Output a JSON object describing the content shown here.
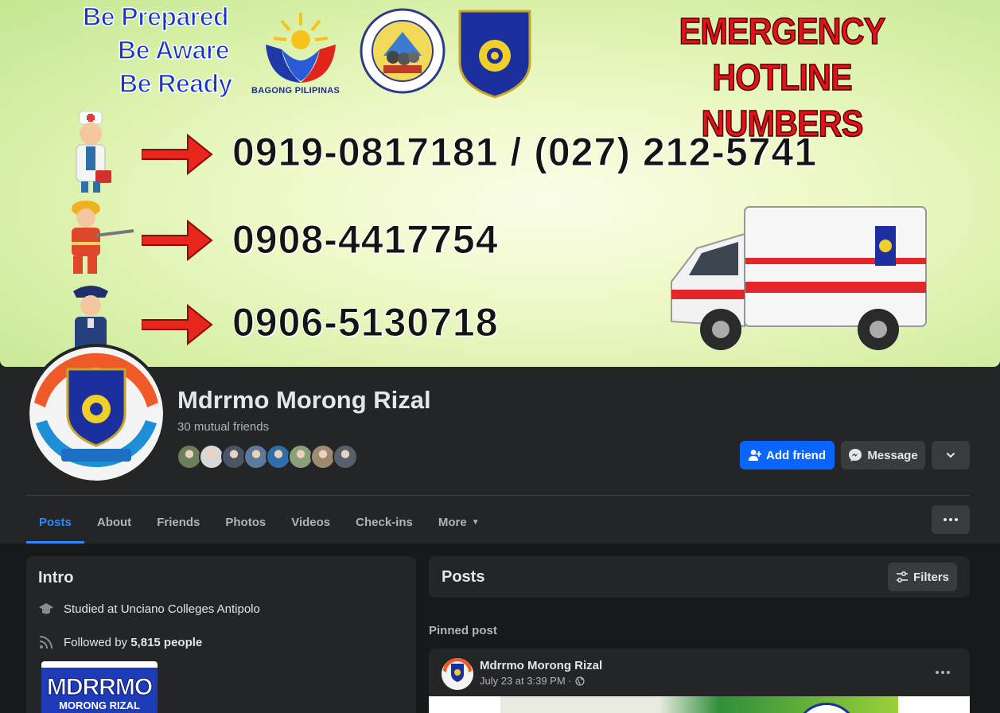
{
  "cover": {
    "slogan": [
      "Be Prepared",
      "Be Aware",
      "Be Ready"
    ],
    "logo_label": "BAGONG PILIPINAS",
    "title_lines": [
      "EMERGENCY HOTLINE",
      "NUMBERS"
    ],
    "hotlines": [
      {
        "service": "medical",
        "number": "0919-0817181 / (027) 212-5741"
      },
      {
        "service": "fire",
        "number": "0908-4417754"
      },
      {
        "service": "police",
        "number": "0906-5130718"
      }
    ]
  },
  "profile": {
    "name": "Mdrrmo Morong Rizal",
    "mutual_friends": "30 mutual friends",
    "friend_avatar_colors": [
      "#6b7f5a",
      "#d8d8d8",
      "#4a5566",
      "#5d7a9a",
      "#2f6fa8",
      "#8aa07a",
      "#9c8b6e",
      "#58606d"
    ]
  },
  "actions": {
    "add_friend": "Add friend",
    "message": "Message"
  },
  "tabs": [
    {
      "label": "Posts",
      "active": true
    },
    {
      "label": "About"
    },
    {
      "label": "Friends"
    },
    {
      "label": "Photos"
    },
    {
      "label": "Videos"
    },
    {
      "label": "Check-ins"
    },
    {
      "label": "More"
    }
  ],
  "intro": {
    "title": "Intro",
    "studied": "Studied at Unciano Colleges Antipolo",
    "followed_prefix": "Followed by ",
    "followed_count": "5,815 people",
    "photo_text_line1": "MDRRMO",
    "photo_text_line2": "MORONG RIZAL"
  },
  "posts": {
    "title": "Posts",
    "filters": "Filters",
    "pinned_label": "Pinned post",
    "pinned_post": {
      "author": "Mdrrmo Morong Rizal",
      "timestamp": "July 23 at 3:39 PM ·"
    }
  },
  "colors": {
    "accent": "#0866ff",
    "tab_active": "#2d88ff",
    "surface": "#242526",
    "background": "#18191a"
  }
}
